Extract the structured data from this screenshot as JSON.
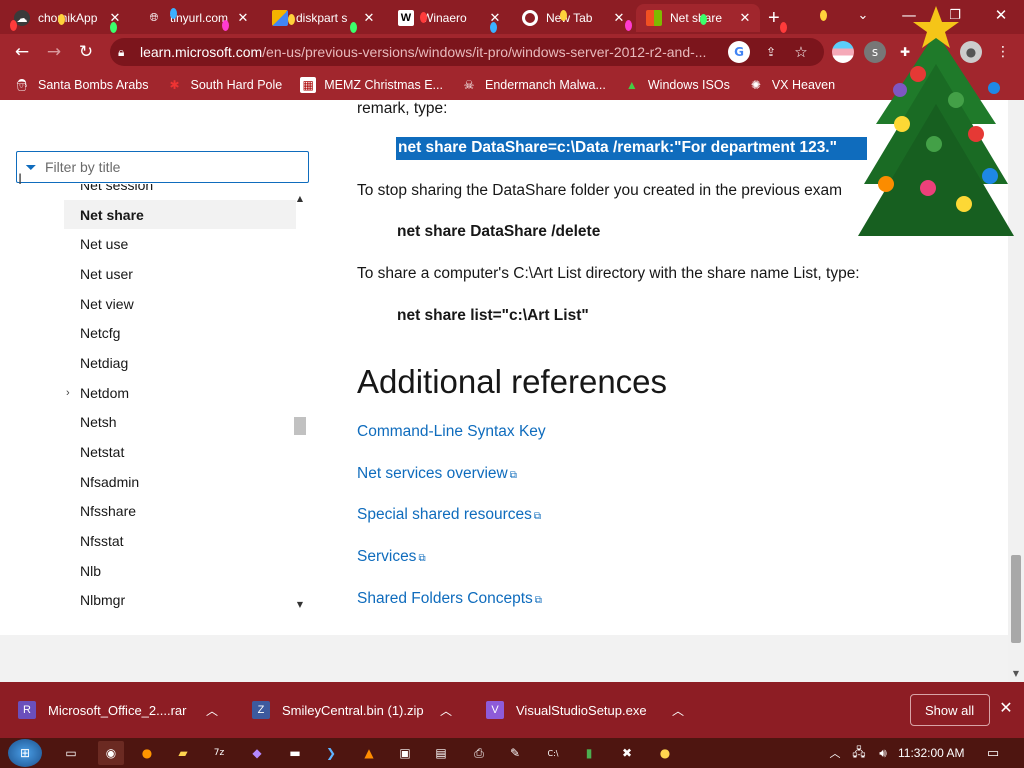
{
  "browser": {
    "tabs": [
      {
        "title": "chomikApp",
        "icon": "cloud-icon",
        "active": false
      },
      {
        "title": "tinyurl.com",
        "icon": "globe-icon",
        "active": false
      },
      {
        "title": "diskpart s",
        "icon": "puzzle-icon",
        "active": false
      },
      {
        "title": "Winaero",
        "icon": "winaero-w-icon",
        "active": false
      },
      {
        "title": "New Tab",
        "icon": "chrome-icon",
        "active": false
      },
      {
        "title": "Net share",
        "icon": "microsoft-icon",
        "active": true
      }
    ],
    "new_tab": "+",
    "address": {
      "domain": "learn.microsoft.com",
      "path": "/en-us/previous-versions/windows/it-pro/windows-server-2012-r2-and-..."
    },
    "bookmarks": [
      {
        "label": "Santa Bombs Arabs",
        "icon": "santa-icon"
      },
      {
        "label": "South Hard Pole",
        "icon": "snowflake-icon"
      },
      {
        "label": "MEMZ Christmas E...",
        "icon": "memz-icon"
      },
      {
        "label": "Endermanch Malwa...",
        "icon": "skull-icon"
      },
      {
        "label": "Windows ISOs",
        "icon": "tree-icon"
      },
      {
        "label": "VX Heaven",
        "icon": "virus-icon"
      }
    ]
  },
  "sidebar": {
    "filter_placeholder": "Filter by title",
    "items": [
      {
        "label": "Net session"
      },
      {
        "label": "Net share",
        "selected": true
      },
      {
        "label": "Net use"
      },
      {
        "label": "Net user"
      },
      {
        "label": "Net view"
      },
      {
        "label": "Netcfg"
      },
      {
        "label": "Netdiag"
      },
      {
        "label": "Netdom",
        "expandable": true
      },
      {
        "label": "Netsh"
      },
      {
        "label": "Netstat"
      },
      {
        "label": "Nfsadmin"
      },
      {
        "label": "Nfsshare"
      },
      {
        "label": "Nfsstat"
      },
      {
        "label": "Nlb"
      },
      {
        "label": "Nlbmgr"
      }
    ]
  },
  "article": {
    "lead_fragment": "remark, type:",
    "code1": "net share DataShare=c:\\Data /remark:\"For department 123.\"",
    "para2": "To stop sharing the DataShare folder you created in the previous exam",
    "code2": "net share DataShare /delete",
    "para3": "To share a computer's C:\\Art List directory with the share name List, type:",
    "code3": "net share list=\"c:\\Art List\"",
    "heading": "Additional references",
    "references": [
      {
        "label": "Command-Line Syntax Key",
        "external": false
      },
      {
        "label": "Net services overview",
        "external": true
      },
      {
        "label": "Special shared resources",
        "external": true
      },
      {
        "label": "Services",
        "external": true
      },
      {
        "label": "Shared Folders Concepts",
        "external": true
      }
    ]
  },
  "downloads": {
    "items": [
      {
        "name": "Microsoft_Office_2....rar"
      },
      {
        "name": "SmileyCentral.bin (1).zip"
      },
      {
        "name": "VisualStudioSetup.exe"
      }
    ],
    "show_all": "Show all"
  },
  "taskbar": {
    "clock": "11:32:00 AM"
  },
  "colors": {
    "chrome_dark": "#8d1d24",
    "chrome": "#a1262d",
    "link": "#0f6cbd",
    "selection": "#0f6cbd"
  }
}
